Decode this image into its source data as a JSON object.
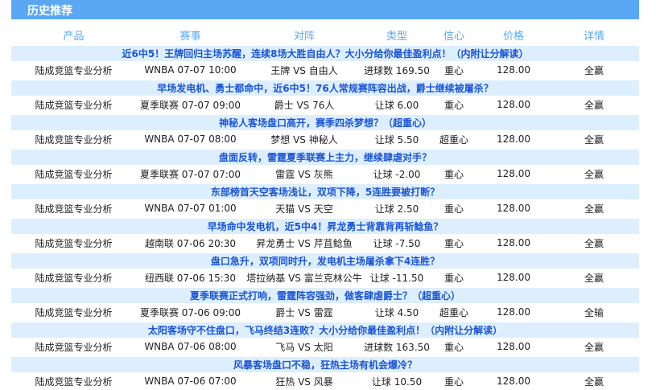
{
  "section_title": "历史推荐",
  "columns": [
    "产品",
    "赛事",
    "对阵",
    "类型",
    "信心",
    "价格",
    "详情"
  ],
  "rows": [
    {
      "title": "近6中5！王牌回归主场苏醒，连续8场大胜自由人？大小分给你最佳盈利点！（内附让分解读）",
      "product": "陆成竞篮专业分析",
      "match": "WNBA 07-07 10:00",
      "vs": "王牌 VS 自由人",
      "type": "进球数 169.50",
      "confidence": "重心",
      "price": "128.00",
      "detail": "全赢"
    },
    {
      "title": "早场发电机、勇士都命中，近6中5！76人常规赛阵容出战，爵士继续被屠杀？",
      "product": "陆成竞篮专业分析",
      "match": "夏季联赛 07-07 09:00",
      "vs": "爵士 VS 76人",
      "type": "让球 6.00",
      "confidence": "重心",
      "price": "128.00",
      "detail": "全赢"
    },
    {
      "title": "神秘人客场盘口高开，赛季四杀梦想？（超重心）",
      "product": "陆成竞篮专业分析",
      "match": "WNBA 07-07 08:00",
      "vs": "梦想 VS 神秘人",
      "type": "让球 5.50",
      "confidence": "超重心",
      "price": "128.00",
      "detail": "全赢"
    },
    {
      "title": "盘面反转，雷霆夏季联赛上主力，继续肆虐对手？",
      "product": "陆成竞篮专业分析",
      "match": "夏季联赛 07-07 07:00",
      "vs": "雷霆 VS 灰熊",
      "type": "让球 -2.00",
      "confidence": "重心",
      "price": "128.00",
      "detail": "全赢"
    },
    {
      "title": "东部榜首天空客场浅让，双项下降，5连胜要被打断？",
      "product": "陆成竞篮专业分析",
      "match": "WNBA 07-07 01:00",
      "vs": "天猫 VS 天空",
      "type": "让球 2.50",
      "confidence": "重心",
      "price": "128.00",
      "detail": "全赢"
    },
    {
      "title": "早场命中发电机，近5中4！昇龙勇士背靠背再斩鲶鱼？",
      "product": "陆成竞篮专业分析",
      "match": "越南联 07-06 20:30",
      "vs": "昇龙勇士 VS 芹苴鲶鱼",
      "type": "让球 -7.50",
      "confidence": "重心",
      "price": "128.00",
      "detail": "全赢"
    },
    {
      "title": "盘口急升，双项同时升，发电机主场屠杀拿下4连胜？",
      "product": "陆成竞篮专业分析",
      "match": "纽西联 07-06 15:30",
      "vs": "塔拉纳基 VS 富兰克林公牛",
      "type": "让球 -11.50",
      "confidence": "重心",
      "price": "128.00",
      "detail": "全赢"
    },
    {
      "title": "夏季联赛正式打响，雷霆阵容强劲，做客肆虐爵士？（超重心）",
      "product": "陆成竞篮专业分析",
      "match": "夏季联赛 07-06 09:00",
      "vs": "爵士 VS 雷霆",
      "type": "让球 4.50",
      "confidence": "超重心",
      "price": "128.00",
      "detail": "全输"
    },
    {
      "title": "太阳客场守不住盘口，飞马终结3连败？大小分给你最佳盈利点！（内附让分解读）",
      "product": "陆成竞篮专业分析",
      "match": "WNBA 07-06 08:00",
      "vs": "飞马 VS 太阳",
      "type": "进球数 163.50",
      "confidence": "重心",
      "price": "128.00",
      "detail": "全赢"
    },
    {
      "title": "风暴客场盘口不稳，狂热主场有机会爆冷？",
      "product": "陆成竞篮专业分析",
      "match": "WNBA 07-06 07:00",
      "vs": "狂热 VS 风暴",
      "type": "让球 10.50",
      "confidence": "重心",
      "price": "128.00",
      "detail": "全赢"
    }
  ]
}
